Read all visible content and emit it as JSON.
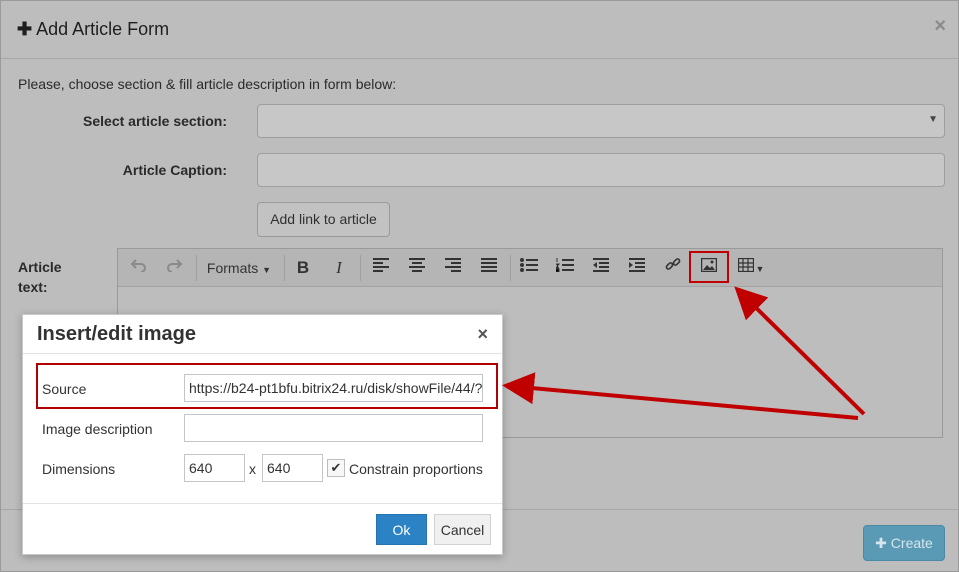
{
  "modal": {
    "title": "Add Article Form",
    "close": "×",
    "intro": "Please, choose section & fill article description in form below:",
    "section_label": "Select article section:",
    "section_value": "",
    "caption_label": "Article Caption:",
    "caption_value": "",
    "add_link_label": "Add link to article",
    "article_text_label_1": "Article",
    "article_text_label_2": "text:",
    "create_label": "Create"
  },
  "editor": {
    "formats_label": "Formats",
    "tools": [
      "undo-icon",
      "redo-icon",
      "bold-icon",
      "italic-icon",
      "align-left-icon",
      "align-center-icon",
      "align-right-icon",
      "justify-icon",
      "bullet-list-icon",
      "numbered-list-icon",
      "outdent-icon",
      "indent-icon",
      "link-icon",
      "image-icon",
      "table-icon"
    ],
    "bold": "B",
    "italic": "I"
  },
  "dialog": {
    "title": "Insert/edit image",
    "close": "×",
    "source_label": "Source",
    "source_value": "https://b24-pt1bfu.bitrix24.ru/disk/showFile/44/?",
    "description_label": "Image description",
    "description_value": "",
    "dimensions_label": "Dimensions",
    "width_value": "640",
    "height_value": "640",
    "x_sep": "x",
    "constrain_label": "Constrain proportions",
    "constrain_checked": true,
    "ok_label": "Ok",
    "cancel_label": "Cancel"
  },
  "colors": {
    "highlight": "#c00000",
    "primary": "#2b82c4"
  }
}
